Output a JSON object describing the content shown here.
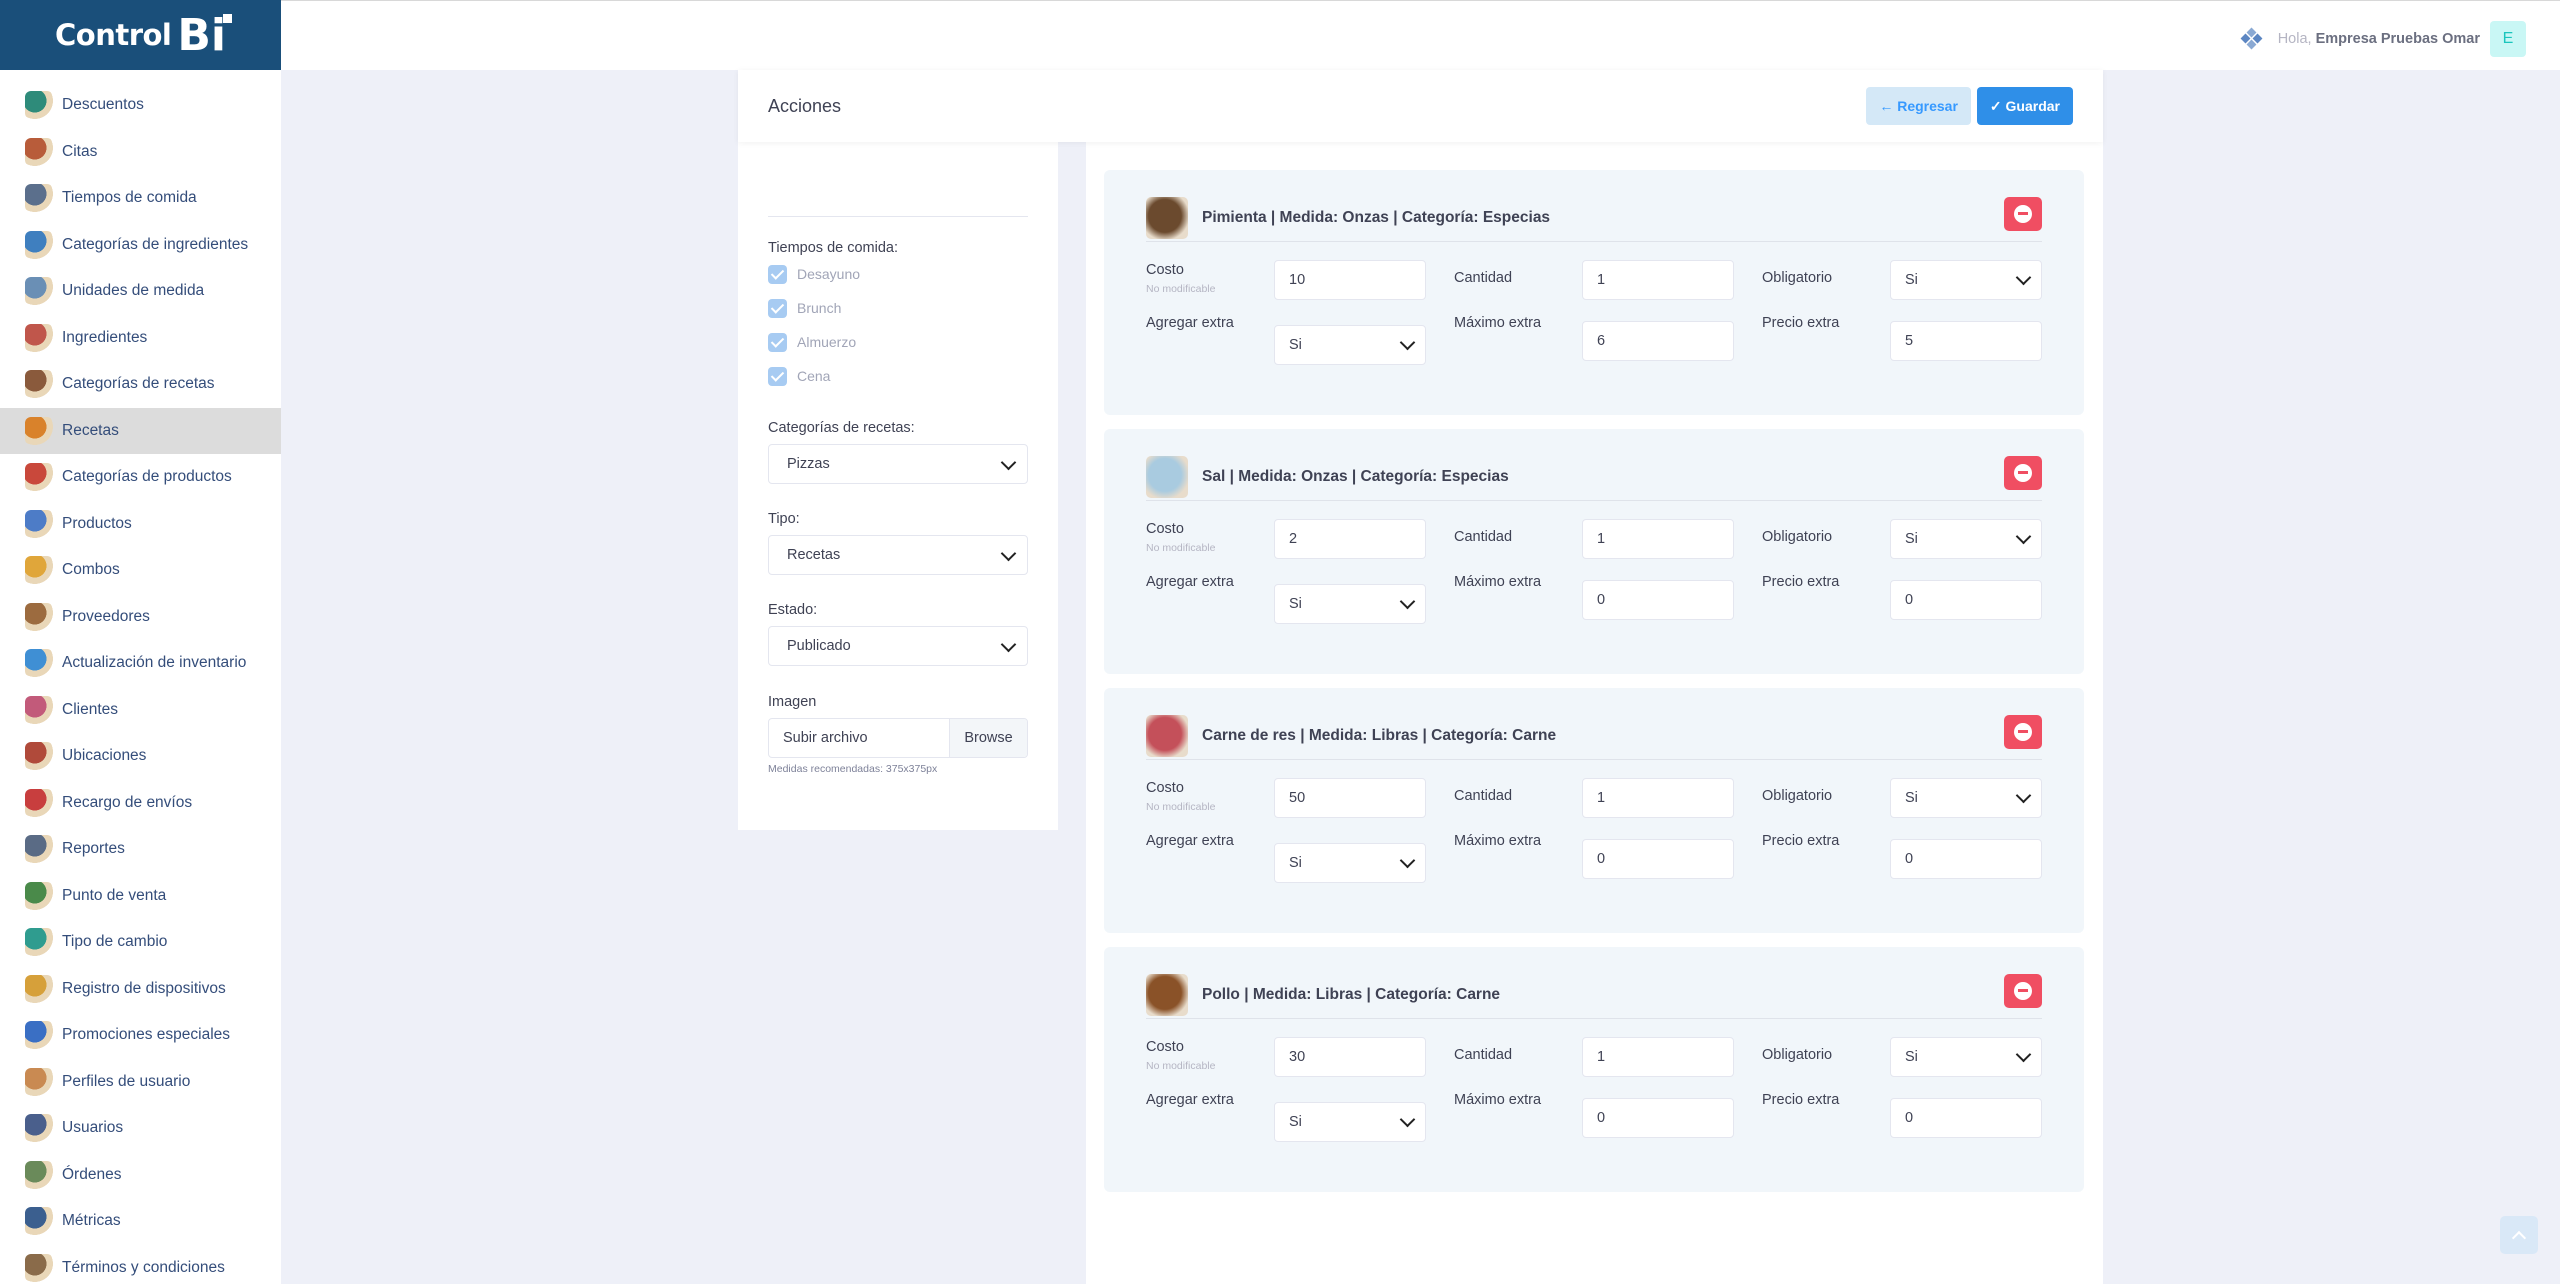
{
  "brand": {
    "name": "Control",
    "mark": "Bi"
  },
  "header": {
    "greeting": "Hola,",
    "user": "Empresa Pruebas Omar",
    "avatar": "E"
  },
  "sidebar": {
    "items": [
      {
        "label": "Descuentos",
        "icon": "discount-icon",
        "color": "#2e8b7a"
      },
      {
        "label": "Citas",
        "icon": "calendar-icon",
        "color": "#b85c3a"
      },
      {
        "label": "Tiempos de comida",
        "icon": "meal-time-icon",
        "color": "#5b6f8c"
      },
      {
        "label": "Categorías de ingredientes",
        "icon": "ingredient-category-icon",
        "color": "#3f7fbf"
      },
      {
        "label": "Unidades de medida",
        "icon": "measure-icon",
        "color": "#6a8fb5"
      },
      {
        "label": "Ingredientes",
        "icon": "ingredients-icon",
        "color": "#c0564b"
      },
      {
        "label": "Categorías de recetas",
        "icon": "recipe-category-icon",
        "color": "#8a5a3c"
      },
      {
        "label": "Recetas",
        "icon": "recipes-icon",
        "color": "#d9822b"
      },
      {
        "label": "Categorías de productos",
        "icon": "product-category-icon",
        "color": "#c9483b"
      },
      {
        "label": "Productos",
        "icon": "products-icon",
        "color": "#4d7cc7"
      },
      {
        "label": "Combos",
        "icon": "combos-icon",
        "color": "#e0a63a"
      },
      {
        "label": "Proveedores",
        "icon": "suppliers-icon",
        "color": "#9c6b3f"
      },
      {
        "label": "Actualización de inventario",
        "icon": "inventory-icon",
        "color": "#3f8fd4"
      },
      {
        "label": "Clientes",
        "icon": "clients-icon",
        "color": "#c25a7a"
      },
      {
        "label": "Ubicaciones",
        "icon": "location-icon",
        "color": "#b04a3a"
      },
      {
        "label": "Recargo de envíos",
        "icon": "delivery-icon",
        "color": "#c83e3e"
      },
      {
        "label": "Reportes",
        "icon": "reports-icon",
        "color": "#5a6b85"
      },
      {
        "label": "Punto de venta",
        "icon": "pos-icon",
        "color": "#4a8a4a"
      },
      {
        "label": "Tipo de cambio",
        "icon": "exchange-icon",
        "color": "#2f9c8f"
      },
      {
        "label": "Registro de dispositivos",
        "icon": "devices-icon",
        "color": "#d6a03a"
      },
      {
        "label": "Promociones especiales",
        "icon": "promotions-icon",
        "color": "#3a6fc4"
      },
      {
        "label": "Perfiles de usuario",
        "icon": "user-profile-icon",
        "color": "#c98a52"
      },
      {
        "label": "Usuarios",
        "icon": "users-icon",
        "color": "#4a5f8c"
      },
      {
        "label": "Órdenes",
        "icon": "orders-icon",
        "color": "#6a8a5a"
      },
      {
        "label": "Métricas",
        "icon": "metrics-icon",
        "color": "#3b5f8f"
      },
      {
        "label": "Términos y condiciones",
        "icon": "terms-icon",
        "color": "#8a6b4a"
      }
    ],
    "active_index": 7
  },
  "toolbar": {
    "title": "Acciones",
    "back_label": "← Regresar",
    "save_label": "✓ Guardar"
  },
  "form": {
    "meal_times_label": "Tiempos de comida:",
    "meal_times": [
      "Desayuno",
      "Brunch",
      "Almuerzo",
      "Cena"
    ],
    "recipe_category_label": "Categorías de recetas:",
    "recipe_category_value": "Pizzas",
    "type_label": "Tipo:",
    "type_value": "Recetas",
    "status_label": "Estado:",
    "status_value": "Publicado",
    "image_label": "Imagen",
    "image_placeholder": "Subir archivo",
    "image_browse": "Browse",
    "image_hint": "Medidas recomendadas: 375x375px"
  },
  "labels": {
    "cost": "Costo",
    "cost_hint": "No modificable",
    "quantity": "Cantidad",
    "required": "Obligatorio",
    "add_extra": "Agregar extra",
    "max_extra": "Máximo extra",
    "extra_price": "Precio extra"
  },
  "ingredients": [
    {
      "title": "Pimienta | Medida: Onzas | Categoría: Especias",
      "thumb": "#6b4a2e",
      "cost": "10",
      "quantity": "1",
      "required": "Si",
      "add_extra": "Si",
      "max_extra": "6",
      "extra_price": "5"
    },
    {
      "title": "Sal | Medida: Onzas | Categoría: Especias",
      "thumb": "#a9cbe0",
      "cost": "2",
      "quantity": "1",
      "required": "Si",
      "add_extra": "Si",
      "max_extra": "0",
      "extra_price": "0"
    },
    {
      "title": "Carne de res | Medida: Libras | Categoría: Carne",
      "thumb": "#c4505a",
      "cost": "50",
      "quantity": "1",
      "required": "Si",
      "add_extra": "Si",
      "max_extra": "0",
      "extra_price": "0"
    },
    {
      "title": "Pollo | Medida: Libras | Categoría: Carne",
      "thumb": "#8a5228",
      "cost": "30",
      "quantity": "1",
      "required": "Si",
      "add_extra": "Si",
      "max_extra": "0",
      "extra_price": "0"
    }
  ]
}
